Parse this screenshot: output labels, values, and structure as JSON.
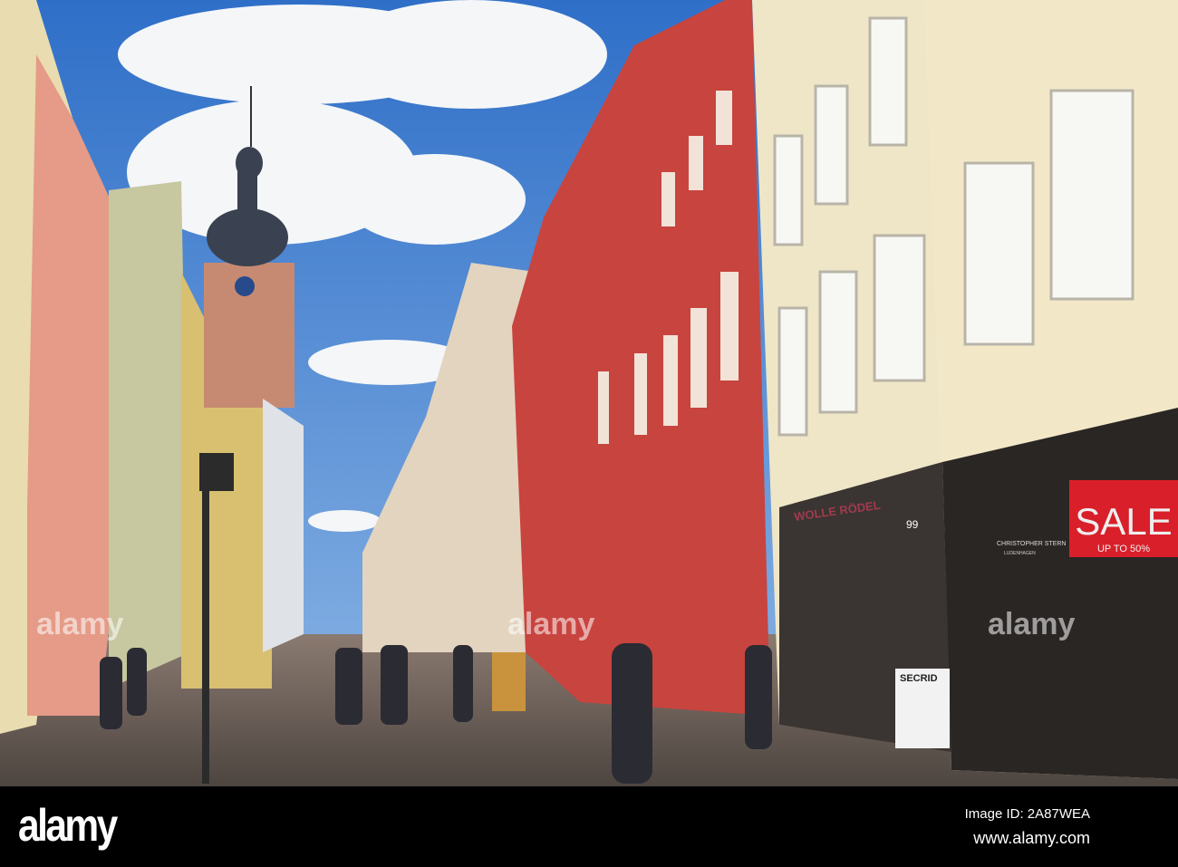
{
  "signs": {
    "sale": "SALE",
    "sale_sub": "UP TO 50%",
    "wolle": "WOLLE RÖDEL",
    "number": "99",
    "christopher": "CHRISTOPHER STERN",
    "christopher_sub": "LUDENHAGEN",
    "secrid": "SECRID"
  },
  "watermark": "alamy",
  "footer": {
    "logo": "alamy",
    "image_id": "Image ID: 2A87WEA",
    "url": "www.alamy.com"
  },
  "colors": {
    "sky": "#3f7fd0",
    "red_building": "#c8443f",
    "cream": "#efe6c8",
    "sale_red": "#d91f2a"
  }
}
